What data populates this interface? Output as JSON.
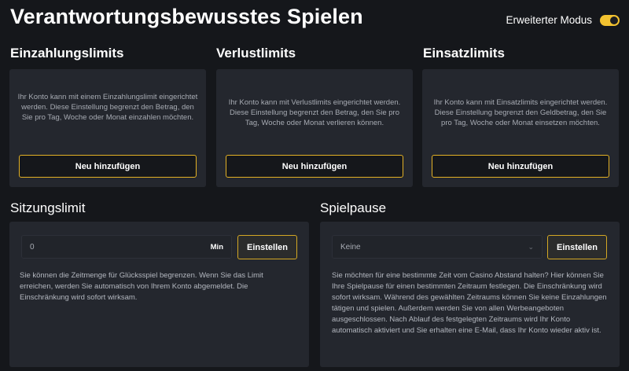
{
  "header": {
    "title": "Verantwortungsbewusstes Spielen",
    "mode_label": "Erweiterter Modus",
    "mode_enabled": true
  },
  "cards": [
    {
      "title": "Einzahlungslimits",
      "text": "Ihr Konto kann mit einem Einzahlungslimit eingerichtet werden. Diese Einstellung begrenzt den Betrag, den Sie pro Tag, Woche oder Monat einzahlen möchten.",
      "button": "Neu hinzufügen"
    },
    {
      "title": "Verlustlimits",
      "text": "Ihr Konto kann mit Verlustlimits eingerichtet werden. Diese Einstellung begrenzt den Betrag, den Sie pro Tag, Woche oder Monat verlieren können.",
      "button": "Neu hinzufügen"
    },
    {
      "title": "Einsatzlimits",
      "text": "Ihr Konto kann mit Einsatzlimits eingerichtet werden. Diese Einstellung begrenzt den Geldbetrag, den Sie pro Tag, Woche oder Monat einsetzen möchten.",
      "button": "Neu hinzufügen"
    }
  ],
  "session": {
    "title": "Sitzungslimit",
    "input_value": "0",
    "unit": "Min",
    "button": "Einstellen",
    "description": "Sie können die Zeitmenge für Glücksspiel begrenzen. Wenn Sie das Limit erreichen, werden Sie automatisch von Ihrem Konto abgemeldet. Die Einschränkung wird sofort wirksam."
  },
  "pause": {
    "title": "Spielpause",
    "select_value": "Keine",
    "button": "Einstellen",
    "description": "Sie möchten für eine bestimmte Zeit vom Casino Abstand halten? Hier können Sie Ihre Spielpause für einen bestimmten Zeitraum festlegen. Die Einschränkung wird sofort wirksam. Während des gewählten Zeitraums können Sie keine Einzahlungen tätigen und spielen. Außerdem werden Sie von allen Werbeangeboten ausgeschlossen. Nach Ablauf des festgelegten Zeitraums wird Ihr Konto automatisch aktiviert und Sie erhalten eine E-Mail, dass Ihr Konto wieder aktiv ist."
  },
  "colors": {
    "background": "#15171b",
    "card": "#24272e",
    "accent": "#e3b125"
  }
}
